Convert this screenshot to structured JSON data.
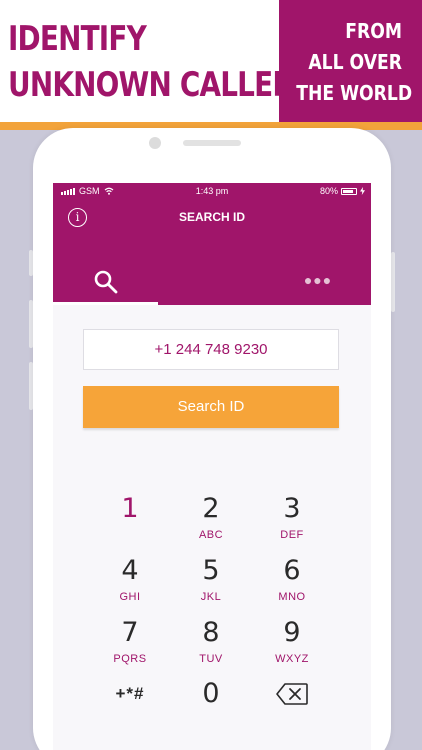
{
  "banner": {
    "left_line1": "IDENTIFY",
    "left_line2": "UNKNOWN CALLERS",
    "right_line1": "FROM",
    "right_line2": "ALL OVER",
    "right_line3": "THE WORLD"
  },
  "status_bar": {
    "carrier": "GSM",
    "time": "1:43 pm",
    "battery": "80%"
  },
  "header": {
    "title": "SEARCH ID",
    "info_icon_glyph": "i",
    "more_glyph": "●●●"
  },
  "search": {
    "number_value": "+1 244 748 9230",
    "button_label": "Search ID"
  },
  "keypad": {
    "keys": [
      {
        "num": "1",
        "letters": ""
      },
      {
        "num": "2",
        "letters": "ABC"
      },
      {
        "num": "3",
        "letters": "DEF"
      },
      {
        "num": "4",
        "letters": "GHI"
      },
      {
        "num": "5",
        "letters": "JKL"
      },
      {
        "num": "6",
        "letters": "MNO"
      },
      {
        "num": "7",
        "letters": "PQRS"
      },
      {
        "num": "8",
        "letters": "TUV"
      },
      {
        "num": "9",
        "letters": "WXYZ"
      }
    ],
    "special": "+*#",
    "zero": "0",
    "delete_icon": "backspace-icon"
  },
  "colors": {
    "brand": "#a0156a",
    "accent": "#f6a439"
  }
}
